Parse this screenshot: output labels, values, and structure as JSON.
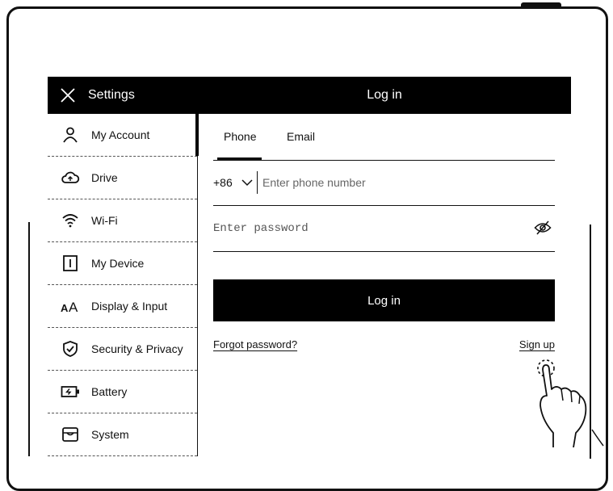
{
  "topbar": {
    "settings_label": "Settings",
    "page_title": "Log in"
  },
  "sidebar": {
    "items": [
      {
        "label": "My Account",
        "icon": "person-icon",
        "active": true
      },
      {
        "label": "Drive",
        "icon": "cloud-drive-icon",
        "active": false
      },
      {
        "label": "Wi-Fi",
        "icon": "wifi-icon",
        "active": false
      },
      {
        "label": "My Device",
        "icon": "device-icon",
        "active": false
      },
      {
        "label": "Display & Input",
        "icon": "font-size-icon",
        "active": false
      },
      {
        "label": "Security & Privacy",
        "icon": "shield-icon",
        "active": false
      },
      {
        "label": "Battery",
        "icon": "battery-icon",
        "active": false
      },
      {
        "label": "System",
        "icon": "system-icon",
        "active": false
      }
    ]
  },
  "login": {
    "tabs": [
      {
        "label": "Phone",
        "active": true
      },
      {
        "label": "Email",
        "active": false
      }
    ],
    "country_code": "+86",
    "phone_placeholder": "Enter phone number",
    "password_placeholder": "Enter password",
    "login_button": "Log in",
    "forgot_password": "Forgot password?",
    "sign_up": "Sign up"
  },
  "colors": {
    "primary": "#000000",
    "background": "#ffffff"
  }
}
